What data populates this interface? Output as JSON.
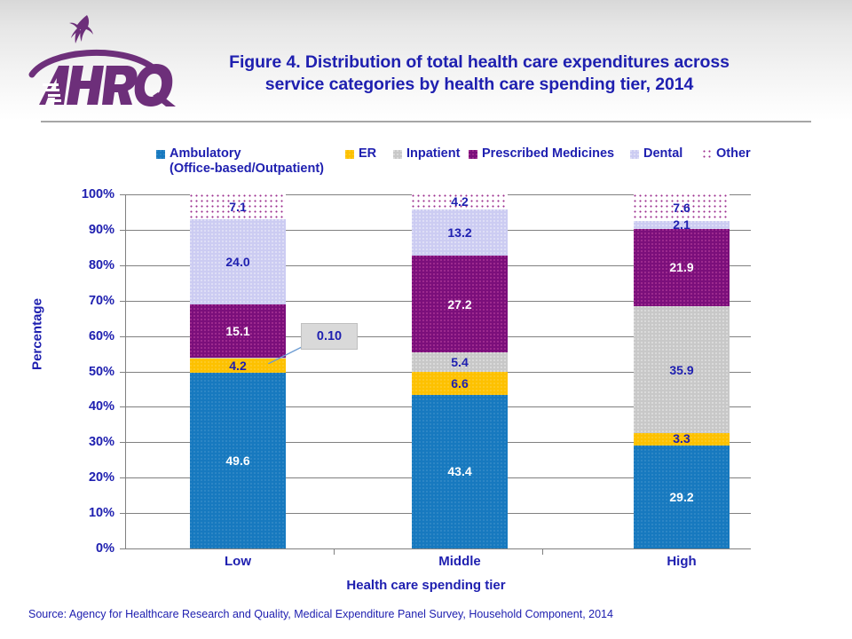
{
  "logo": {
    "agency_acronym": "AHRQ",
    "seal_name": "hhs-eagle-seal"
  },
  "title": {
    "line1": "Figure 4. Distribution of total health care expenditures across",
    "line2": "service categories by health care spending tier, 2014"
  },
  "source": {
    "text": "Source: Agency for Healthcare Research and Quality, Medical Expenditure Panel Survey,  Household Component, 2014"
  },
  "callout": {
    "value": "0.10"
  },
  "chart_data": {
    "type": "bar",
    "subtype": "stacked-100-percent",
    "title": "Figure 4. Distribution of total health care expenditures across service categories by health care spending tier, 2014",
    "xlabel": "Health care spending tier",
    "ylabel": "Percentage",
    "categories": [
      "Low",
      "Middle",
      "High"
    ],
    "ylim": [
      0,
      100
    ],
    "ytick_labels": [
      "0%",
      "10%",
      "20%",
      "30%",
      "40%",
      "50%",
      "60%",
      "70%",
      "80%",
      "90%",
      "100%"
    ],
    "ytick_values": [
      0,
      10,
      20,
      30,
      40,
      50,
      60,
      70,
      80,
      90,
      100
    ],
    "grid": true,
    "legend_position": "top",
    "series": [
      {
        "name": "Ambulatory",
        "name_line2": "(Office-based/Outpatient)",
        "key": "ambulatory",
        "color": "#1779bf",
        "label_color": "#ffffff",
        "values": [
          49.6,
          43.4,
          29.2
        ],
        "labels": [
          "49.6",
          "43.4",
          "29.2"
        ]
      },
      {
        "name": "ER",
        "key": "er",
        "color": "#fdc100",
        "label_color": "#1f20b0",
        "values": [
          4.2,
          6.6,
          3.3
        ],
        "labels": [
          "4.2",
          "6.6",
          "3.3"
        ]
      },
      {
        "name": "Inpatient",
        "key": "inpatient",
        "color": "#c8c8c8",
        "label_color": "#1f20b0",
        "values": [
          0.1,
          5.4,
          35.9
        ],
        "labels": [
          "0.10",
          "5.4",
          "35.9"
        ]
      },
      {
        "name": "Prescribed Medicines",
        "key": "prescribed",
        "color": "#7b0f7b",
        "label_color": "#ffffff",
        "values": [
          15.1,
          27.2,
          21.9
        ],
        "labels": [
          "15.1",
          "27.2",
          "21.9"
        ]
      },
      {
        "name": "Dental",
        "key": "dental",
        "color": "#ccccf2",
        "label_color": "#1f20b0",
        "values": [
          24.0,
          13.2,
          2.1
        ],
        "labels": [
          "24.0",
          "13.2",
          "2.1"
        ]
      },
      {
        "name": "Other",
        "key": "other",
        "color": "#ffffff",
        "pattern": "dotted-stipple",
        "label_color": "#1f20b0",
        "values": [
          7.1,
          4.2,
          7.6
        ],
        "labels": [
          "7.1",
          "4.2",
          "7.6"
        ]
      }
    ]
  }
}
